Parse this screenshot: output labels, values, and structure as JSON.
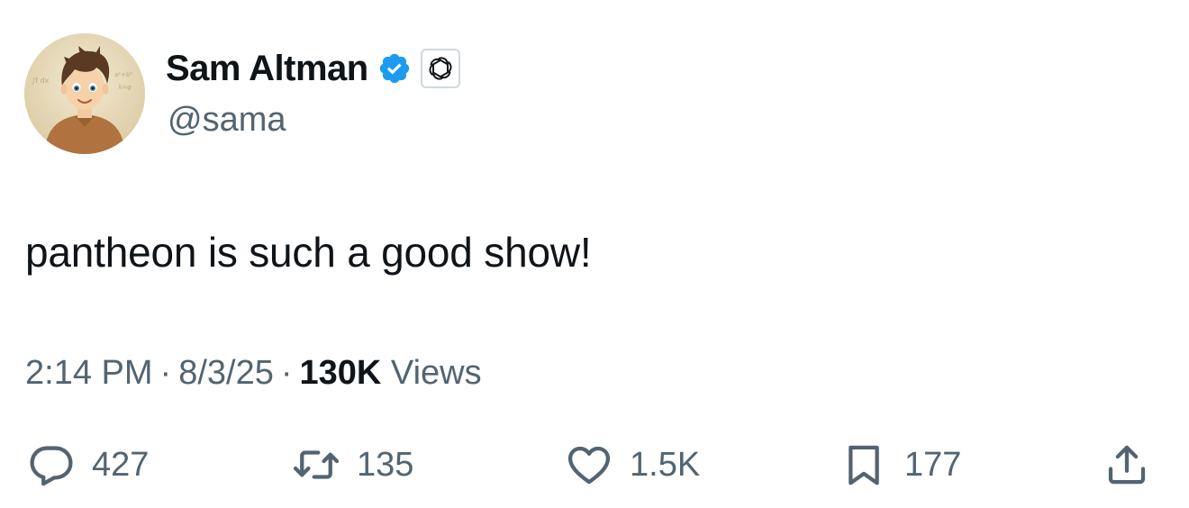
{
  "author": {
    "name": "Sam Altman",
    "handle": "@sama",
    "avatar_icon": "cartoon-avatar",
    "verified_icon": "verified-badge-icon",
    "verified_color": "#1d9bf0",
    "affiliation_icon": "openai-logo-icon"
  },
  "tweet": {
    "text": "pantheon is such a good show!"
  },
  "meta": {
    "time": "2:14 PM",
    "date": "8/3/25",
    "separator": "·",
    "views_count": "130K",
    "views_label": "Views"
  },
  "actions": {
    "reply": {
      "icon": "reply-icon",
      "count": "427"
    },
    "retweet": {
      "icon": "retweet-icon",
      "count": "135"
    },
    "like": {
      "icon": "heart-icon",
      "count": "1.5K"
    },
    "bookmark": {
      "icon": "bookmark-icon",
      "count": "177"
    },
    "share": {
      "icon": "share-icon"
    }
  },
  "colors": {
    "text_primary": "#0f1419",
    "text_secondary": "#536471",
    "accent": "#1d9bf0"
  }
}
